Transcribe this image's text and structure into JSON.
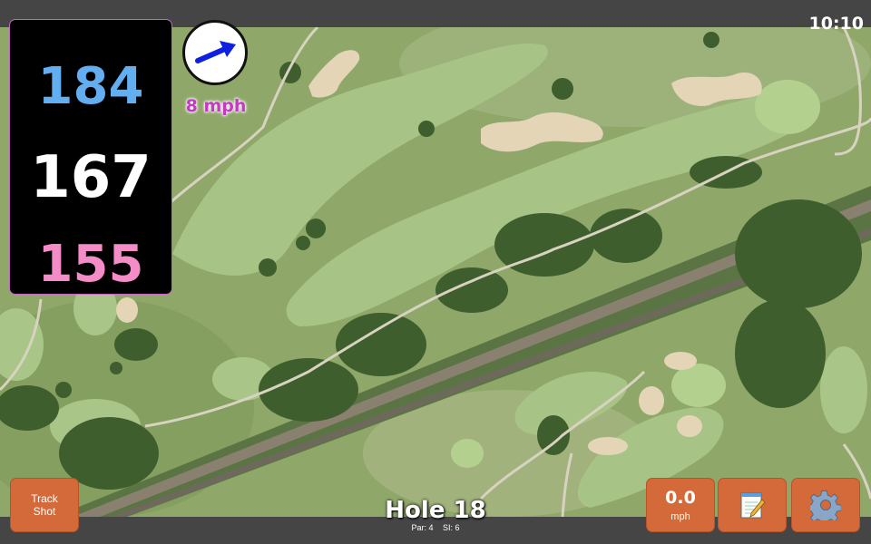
{
  "status": {
    "time": "10:10"
  },
  "distances": {
    "back": "184",
    "middle": "167",
    "front": "155"
  },
  "wind": {
    "speed": "8 mph",
    "arrow_icon": "wind-direction-arrow-icon"
  },
  "hole": {
    "title": "Hole 18",
    "par": "Par: 4",
    "stroke_index": "SI: 6"
  },
  "buttons": {
    "track_shot": [
      "Track",
      "Shot"
    ],
    "speed": {
      "value": "0.0",
      "unit": "mph"
    },
    "notes_icon": "notepad-icon",
    "settings_icon": "gear-icon"
  },
  "colors": {
    "back": "#62aef0",
    "middle": "#ffffff",
    "front": "#f48cc8",
    "button": "#d46a3a",
    "wind_text": "#c33ac3"
  }
}
